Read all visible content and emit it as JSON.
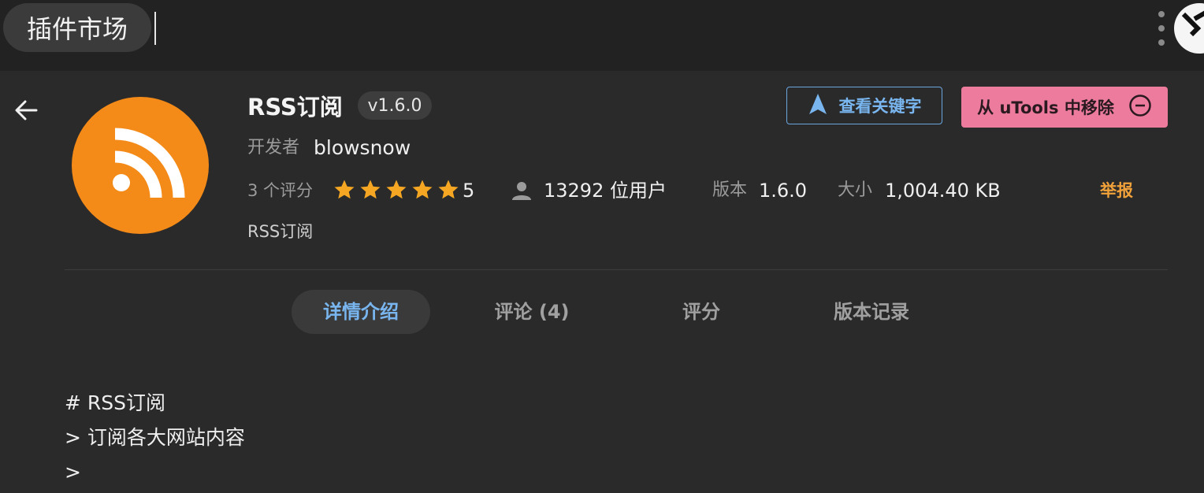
{
  "topbar": {
    "title": "插件市场",
    "menu_icon": "vertical-dots-icon",
    "logo_icon": "utools-logo-icon"
  },
  "plugin": {
    "name": "RSS订阅",
    "version_badge": "v1.6.0",
    "developer_label": "开发者",
    "developer": "blowsnow",
    "rating_count": "3 个评分",
    "stars": 5,
    "rating_score": "5",
    "users": "13292 位用户",
    "version_label": "版本",
    "version": "1.6.0",
    "size_label": "大小",
    "size": "1,004.40 KB",
    "report": "举报",
    "summary": "RSS订阅",
    "icon": "rss-icon"
  },
  "actions": {
    "keywords_label": "查看关键字",
    "remove_label": "从 uTools 中移除"
  },
  "tabs": [
    {
      "label": "详情介绍",
      "active": true
    },
    {
      "label": "评论 (4)",
      "active": false
    },
    {
      "label": "评分",
      "active": false
    },
    {
      "label": "版本记录",
      "active": false
    }
  ],
  "content": {
    "lines": [
      "# RSS订阅",
      "> 订阅各大网站内容",
      ">"
    ]
  },
  "colors": {
    "accent_blue": "#79b6f0",
    "remove_pink": "#ec7b9e",
    "star_orange": "#f5a623",
    "icon_orange": "#f48a18",
    "report_orange": "#f0a13a"
  }
}
